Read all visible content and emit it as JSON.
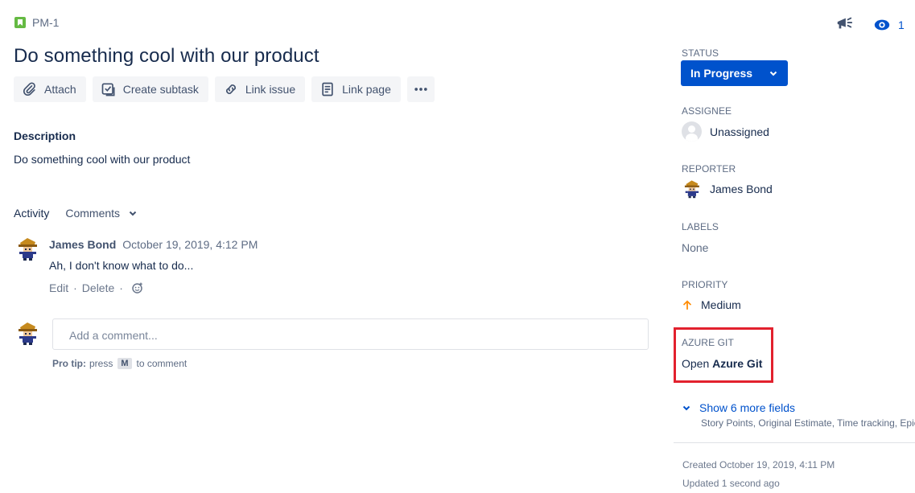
{
  "issue": {
    "key": "PM-1",
    "title": "Do something cool with our product"
  },
  "toolbar": {
    "attach": "Attach",
    "create_subtask": "Create subtask",
    "link_issue": "Link issue",
    "link_page": "Link page"
  },
  "description": {
    "label": "Description",
    "text": "Do something cool with our product"
  },
  "activity": {
    "label": "Activity",
    "filter": "Comments"
  },
  "comment": {
    "author": "James Bond",
    "date": "October 19, 2019, 4:12 PM",
    "body": "Ah, I don't know what to do...",
    "edit": "Edit",
    "delete": "Delete",
    "separator": "·"
  },
  "new_comment": {
    "placeholder": "Add a comment...",
    "protip_label": "Pro tip:",
    "protip_press": "press",
    "protip_key": "M",
    "protip_suffix": "to comment"
  },
  "watchers": {
    "count": "1"
  },
  "sidebar": {
    "status_label": "STATUS",
    "status_value": "In Progress",
    "assignee_label": "ASSIGNEE",
    "assignee_value": "Unassigned",
    "reporter_label": "REPORTER",
    "reporter_value": "James Bond",
    "labels_label": "LABELS",
    "labels_value": "None",
    "priority_label": "PRIORITY",
    "priority_value": "Medium",
    "azure_label": "AZURE GIT",
    "azure_open": "Open",
    "azure_name": "Azure Git",
    "more_fields": "Show 6 more fields",
    "more_fields_sub": "Story Points, Original Estimate, Time tracking, Epic Link",
    "created": "Created October 19, 2019, 4:11 PM",
    "updated": "Updated 1 second ago"
  },
  "colors": {
    "primary": "#0052cc",
    "story_green": "#65ba43",
    "highlight_red": "#e2212e",
    "priority_orange": "#ff8b00"
  }
}
